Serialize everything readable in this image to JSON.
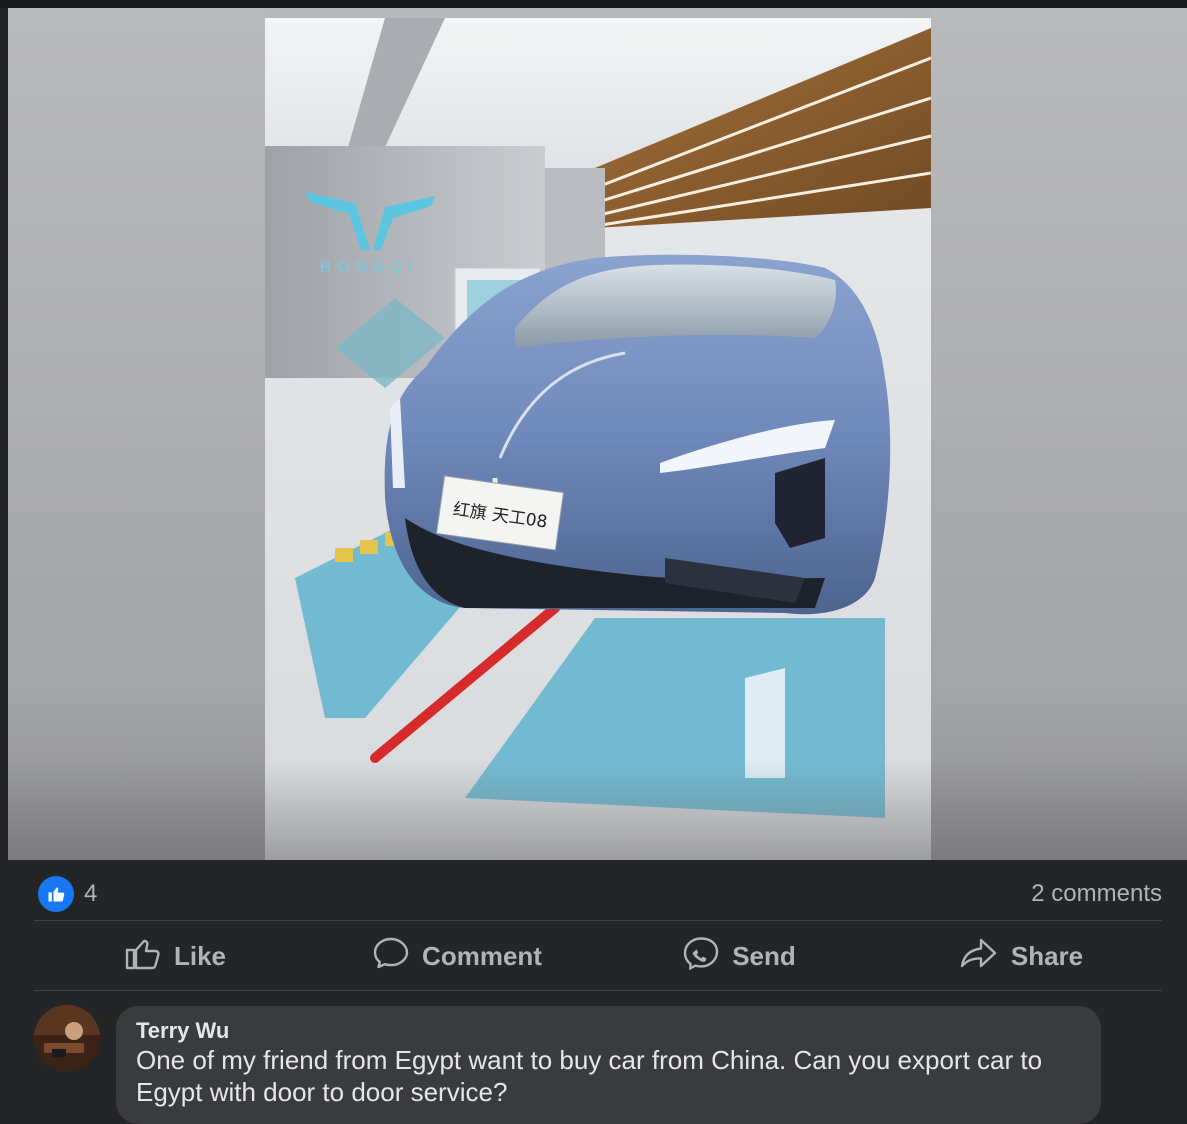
{
  "post": {
    "media": {
      "logo_text": "HONGQI",
      "plate_text": "红旗 天工08"
    },
    "reactions": {
      "icon": "like-icon",
      "count": "4",
      "comments_label": "2 comments"
    },
    "actions": [
      {
        "label": "Like",
        "icon": "thumbs-up-icon"
      },
      {
        "label": "Comment",
        "icon": "comment-bubble-icon"
      },
      {
        "label": "Send",
        "icon": "messenger-icon"
      },
      {
        "label": "Share",
        "icon": "share-arrow-icon"
      }
    ]
  },
  "comment": {
    "author": "Terry Wu",
    "text": "One of my friend from Egypt want to buy car from China. Can you export car to Egypt with door to door service?"
  },
  "colors": {
    "background": "#242526",
    "accent": "#1877f2",
    "muted_text": "#b0b3b8",
    "bubble": "#3a3b3c",
    "car_body": "#7a93c2"
  }
}
